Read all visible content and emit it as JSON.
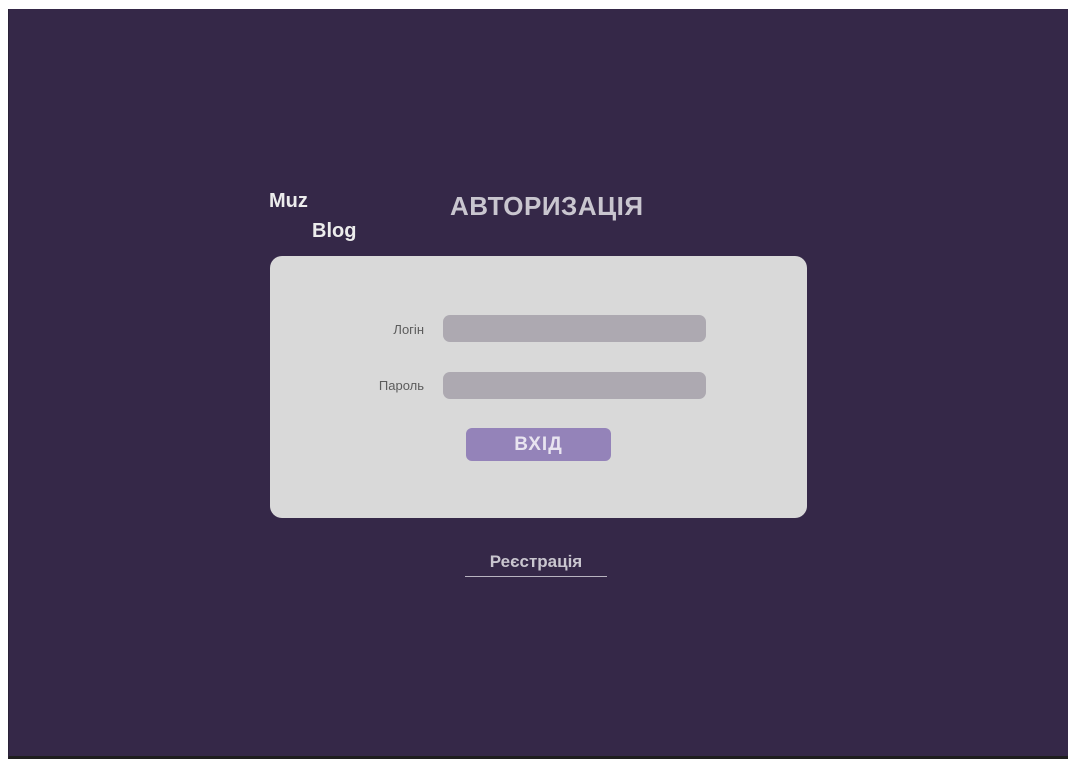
{
  "logo": {
    "line1": "Muz",
    "line2": "Blog"
  },
  "title": "АВТОРИЗАЦІЯ",
  "form": {
    "login_label": "Логін",
    "login_value": "",
    "password_label": "Пароль",
    "password_value": "",
    "submit_label": "ВХІД"
  },
  "register_link": "Реєстрація",
  "colors": {
    "background": "#352848",
    "card": "#d9d9d9",
    "input": "#ada9b1",
    "button": "#9483b9",
    "title_text": "#c9c6cf"
  }
}
